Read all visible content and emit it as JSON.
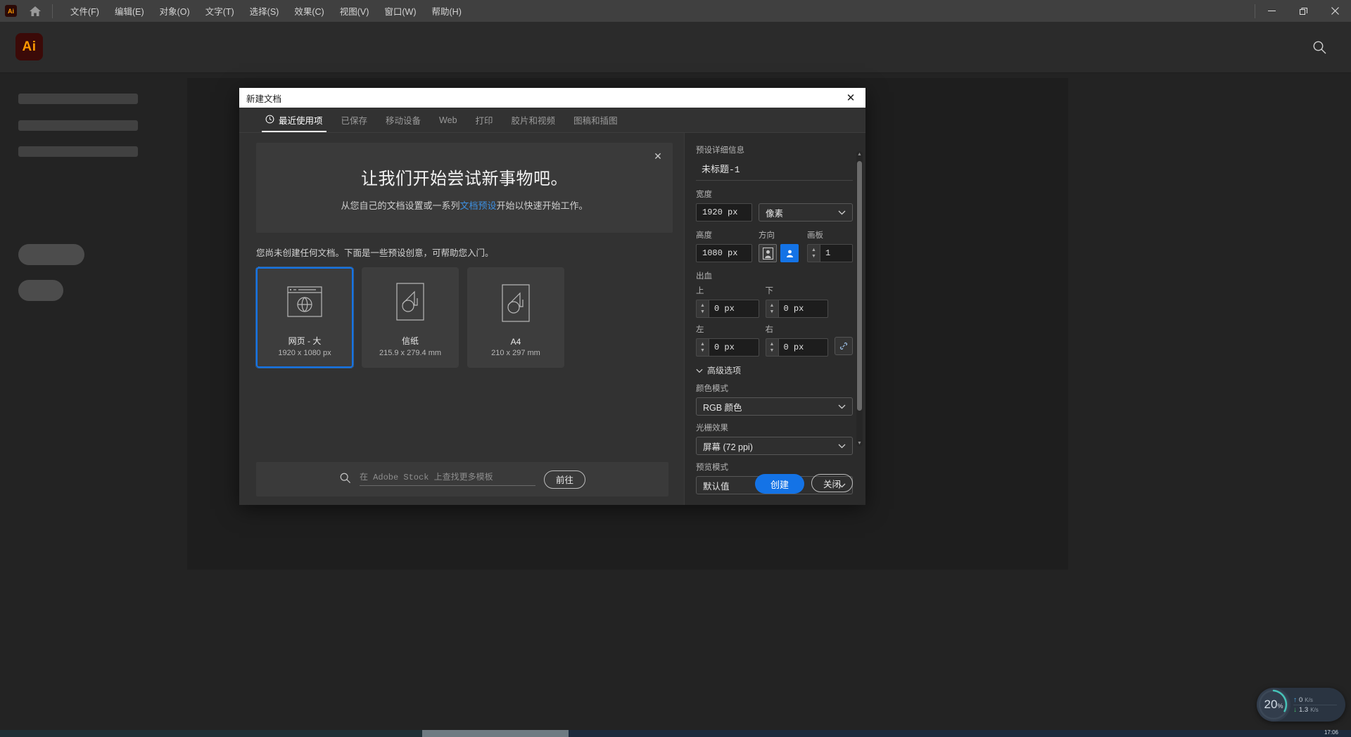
{
  "os_bar": {
    "app_badge": "Ai",
    "home_icon": "home-icon",
    "menus": [
      {
        "label": "文件(F)"
      },
      {
        "label": "编辑(E)"
      },
      {
        "label": "对象(O)"
      },
      {
        "label": "文字(T)"
      },
      {
        "label": "选择(S)"
      },
      {
        "label": "效果(C)"
      },
      {
        "label": "视图(V)"
      },
      {
        "label": "窗口(W)"
      },
      {
        "label": "帮助(H)"
      }
    ],
    "window_controls": {
      "minimize": "−",
      "restore": "❐",
      "close": "✕"
    }
  },
  "app_header": {
    "logo": "Ai",
    "search_icon": "search-icon"
  },
  "dialog": {
    "title": "新建文档",
    "close_label": "✕",
    "tabs": [
      {
        "label": "最近使用项",
        "active": true,
        "icon": "clock-icon"
      },
      {
        "label": "已保存",
        "active": false
      },
      {
        "label": "移动设备",
        "active": false
      },
      {
        "label": "Web",
        "active": false
      },
      {
        "label": "打印",
        "active": false
      },
      {
        "label": "胶片和视频",
        "active": false
      },
      {
        "label": "图稿和插图",
        "active": false
      }
    ],
    "banner": {
      "heading": "让我们开始尝试新事物吧。",
      "text_before_link": "从您自己的文档设置或一系列",
      "link_text": "文档预设",
      "text_after_link": "开始以快速开始工作。",
      "close_label": "✕",
      "link_color": "#3d8fe0"
    },
    "hint": "您尚未创建任何文档。下面是一些预设创意，可帮助您入门。",
    "presets": [
      {
        "name": "网页 - 大",
        "dimensions": "1920 x 1080 px",
        "icon": "web-page-icon",
        "selected": true
      },
      {
        "name": "信纸",
        "dimensions": "215.9 x 279.4 mm",
        "icon": "document-icon",
        "selected": false
      },
      {
        "name": "A4",
        "dimensions": "210 x 297 mm",
        "icon": "document-icon",
        "selected": false
      }
    ],
    "stock": {
      "search_icon": "search-icon",
      "placeholder": "在 Adobe Stock 上查找更多模板",
      "value": "",
      "go_button": "前往"
    },
    "details": {
      "section_title": "预设详细信息",
      "preset_name": "未标题-1",
      "width_label": "宽度",
      "width_value": "1920 px",
      "unit_value": "像素",
      "height_label": "高度",
      "height_value": "1080 px",
      "orientation_label": "方向",
      "orientation_portrait_icon": "portrait-icon",
      "orientation_landscape_icon": "landscape-icon",
      "orientation_selected": "landscape",
      "artboards_label": "画板",
      "artboards_value": "1",
      "bleed_label": "出血",
      "bleed": [
        {
          "label": "上",
          "value": "0 px"
        },
        {
          "label": "下",
          "value": "0 px"
        },
        {
          "label": "左",
          "value": "0 px"
        },
        {
          "label": "右",
          "value": "0 px"
        }
      ],
      "link_icon": "link-chain-icon",
      "advanced_label": "高级选项",
      "advanced_chevron": "chevron-down-icon",
      "color_mode_label": "颜色模式",
      "color_mode_value": "RGB 颜色",
      "raster_label": "光栅效果",
      "raster_value": "屏幕 (72 ppi)",
      "preview_label": "预览模式",
      "preview_value": "默认值"
    },
    "actions": {
      "create": "创建",
      "close": "关闭",
      "accent_color": "#1473e6"
    }
  },
  "perf_widget": {
    "percent": "20",
    "percent_symbol": "%",
    "upload_arrow": "↑",
    "upload_value": "0",
    "upload_unit": "K/s",
    "download_arrow": "↓",
    "download_value": "1.3",
    "download_unit": "K/s"
  },
  "taskbar": {
    "time": "17:06"
  }
}
